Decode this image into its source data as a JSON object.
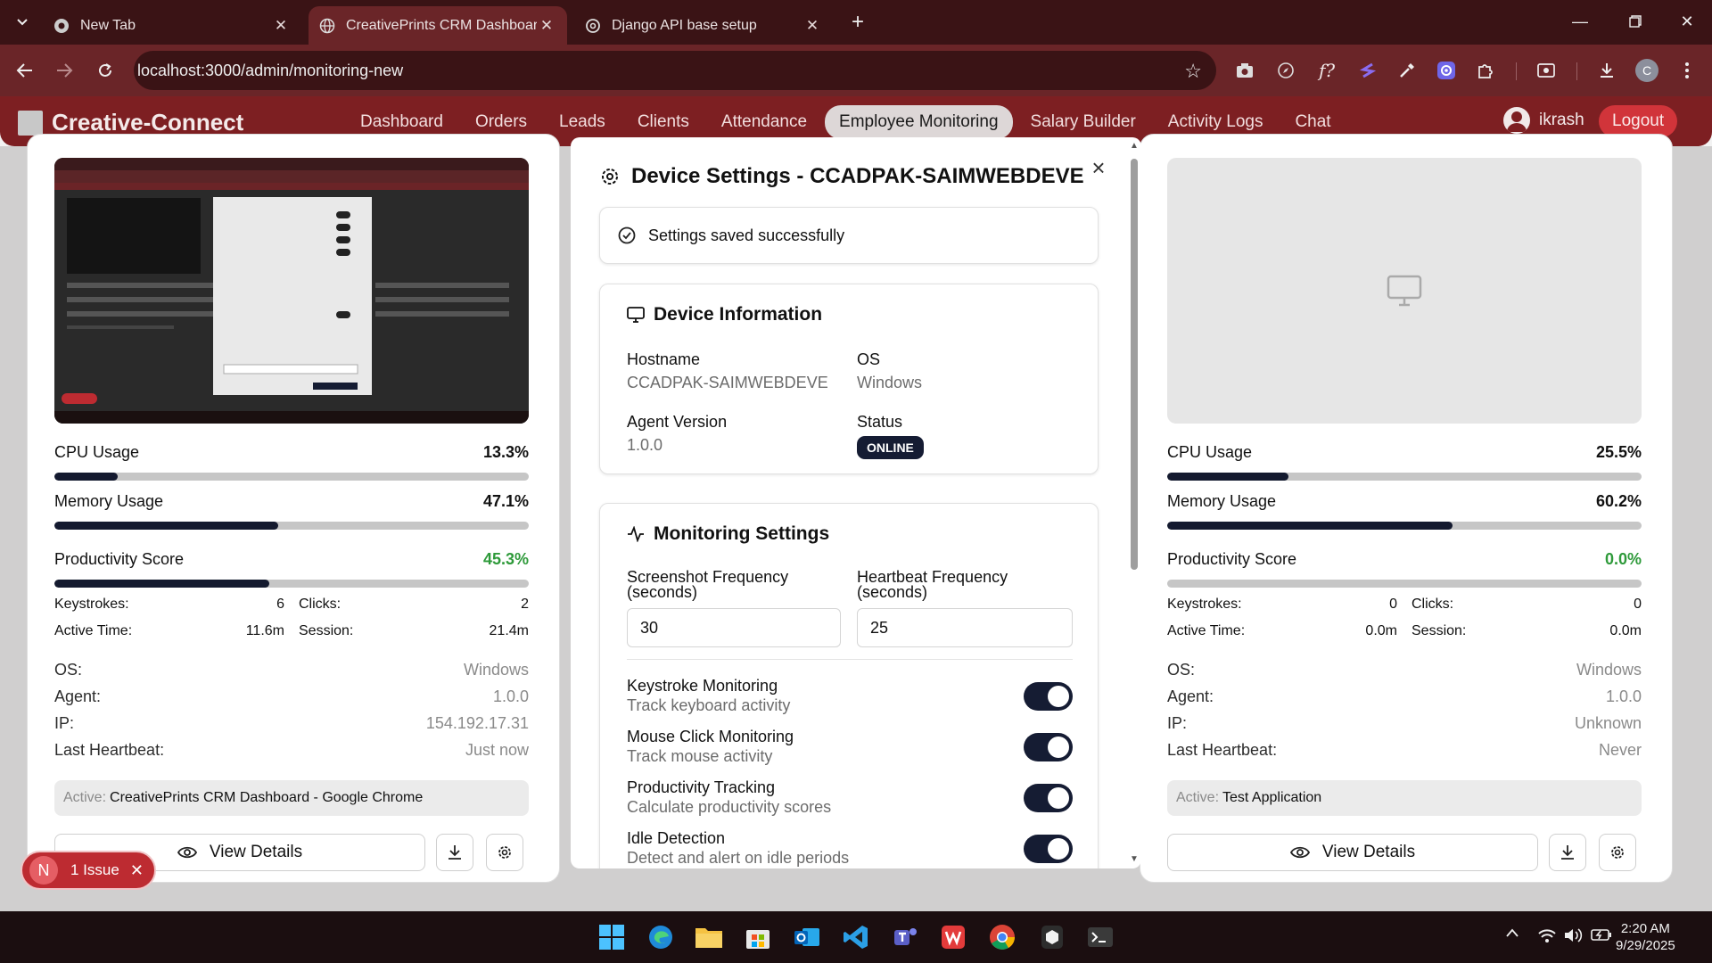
{
  "browser": {
    "tabs": [
      {
        "title": "New Tab",
        "active": false
      },
      {
        "title": "CreativePrints CRM Dashboard",
        "active": true
      },
      {
        "title": "Django API base setup",
        "active": false
      }
    ],
    "url": "localhost:3000/admin/monitoring-new",
    "profile_initial": "C"
  },
  "app": {
    "brand": "Creative-Connect",
    "nav": [
      "Dashboard",
      "Orders",
      "Leads",
      "Clients",
      "Attendance",
      "Employee Monitoring",
      "Salary Builder",
      "Activity Logs",
      "Chat"
    ],
    "active_nav": "Employee Monitoring",
    "user": "ikrash",
    "logout": "Logout"
  },
  "cards": [
    {
      "cpu_label": "CPU Usage",
      "cpu_value": "13.3%",
      "cpu_level": 0.133,
      "memory_label": "Memory Usage",
      "memory_value": "47.1%",
      "memory_level": 0.471,
      "productivity_label": "Productivity Score",
      "productivity_value": "45.3%",
      "productivity_level": 0.453,
      "keystrokes_label": "Keystrokes:",
      "keystrokes": "6",
      "clicks_label": "Clicks:",
      "clicks": "2",
      "active_time_label": "Active Time:",
      "active_time": "11.6m",
      "session_label": "Session:",
      "session": "21.4m",
      "os_label": "OS:",
      "os": "Windows",
      "agent_label": "Agent:",
      "agent": "1.0.0",
      "ip_label": "IP:",
      "ip": "154.192.17.31",
      "heartbeat_label": "Last Heartbeat:",
      "heartbeat": "Just now",
      "active_label": "Active:",
      "active_app": "CreativePrints CRM Dashboard - Google Chrome",
      "view_details": "View Details"
    },
    {
      "cpu_label": "CPU Usage",
      "cpu_value": "25.5%",
      "cpu_level": 0.255,
      "memory_label": "Memory Usage",
      "memory_value": "60.2%",
      "memory_level": 0.602,
      "productivity_label": "Productivity Score",
      "productivity_value": "0.0%",
      "productivity_level": 0.0,
      "keystrokes_label": "Keystrokes:",
      "keystrokes": "0",
      "clicks_label": "Clicks:",
      "clicks": "0",
      "active_time_label": "Active Time:",
      "active_time": "0.0m",
      "session_label": "Session:",
      "session": "0.0m",
      "os_label": "OS:",
      "os": "Windows",
      "agent_label": "Agent:",
      "agent": "1.0.0",
      "ip_label": "IP:",
      "ip": "Unknown",
      "heartbeat_label": "Last Heartbeat:",
      "heartbeat": "Never",
      "active_label": "Active:",
      "active_app": "Test Application",
      "view_details": "View Details"
    }
  ],
  "modal": {
    "title": "Device Settings - CCADPAK-SAIMWEBDEVE",
    "success": "Settings saved successfully",
    "device_info": {
      "heading": "Device Information",
      "hostname_label": "Hostname",
      "hostname": "CCADPAK-SAIMWEBDEVE",
      "os_label": "OS",
      "os": "Windows",
      "agent_label": "Agent Version",
      "agent": "1.0.0",
      "status_label": "Status",
      "status": "ONLINE"
    },
    "monitoring": {
      "heading": "Monitoring Settings",
      "screenshot_freq_label": "Screenshot Frequency (seconds)",
      "screenshot_freq": "30",
      "heartbeat_freq_label": "Heartbeat Frequency (seconds)",
      "heartbeat_freq": "25",
      "toggles": [
        {
          "label": "Keystroke Monitoring",
          "desc": "Track keyboard activity",
          "on": true
        },
        {
          "label": "Mouse Click Monitoring",
          "desc": "Track mouse activity",
          "on": true
        },
        {
          "label": "Productivity Tracking",
          "desc": "Calculate productivity scores",
          "on": true
        },
        {
          "label": "Idle Detection",
          "desc": "Detect and alert on idle periods",
          "on": true
        }
      ]
    }
  },
  "issue_badge": {
    "initial": "N",
    "text": "1 Issue"
  },
  "clock": {
    "time": "2:20 AM",
    "date": "9/29/2025"
  },
  "colors": {
    "brand": "#7d1f22",
    "accent_dark": "#151c33",
    "positive": "#2e9a3a",
    "logout": "#d1343a"
  }
}
